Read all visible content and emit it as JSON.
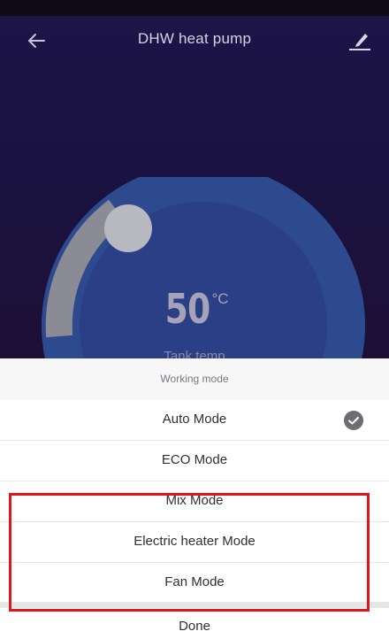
{
  "header": {
    "title": "DHW heat pump",
    "back_icon": "arrow-left-icon",
    "edit_icon": "pen-edit-icon"
  },
  "gauge": {
    "temperature": "50",
    "unit": "°C",
    "caption": "Tank temp",
    "colors": {
      "outer_ring": "#2d4a8f",
      "inner_disc": "#2b3f86",
      "track": "#8b8b95",
      "knob": "#b8b8c0"
    }
  },
  "sheet": {
    "title": "Working mode",
    "options": [
      {
        "label": "Auto Mode",
        "selected": true
      },
      {
        "label": "ECO Mode",
        "selected": false
      },
      {
        "label": "Mix Mode",
        "selected": false
      },
      {
        "label": "Electric heater Mode",
        "selected": false
      },
      {
        "label": "Fan Mode",
        "selected": false
      }
    ],
    "done_label": "Done",
    "check_icon": "check-circle-icon"
  },
  "annotation": {
    "highlight_color": "#e0161c"
  }
}
